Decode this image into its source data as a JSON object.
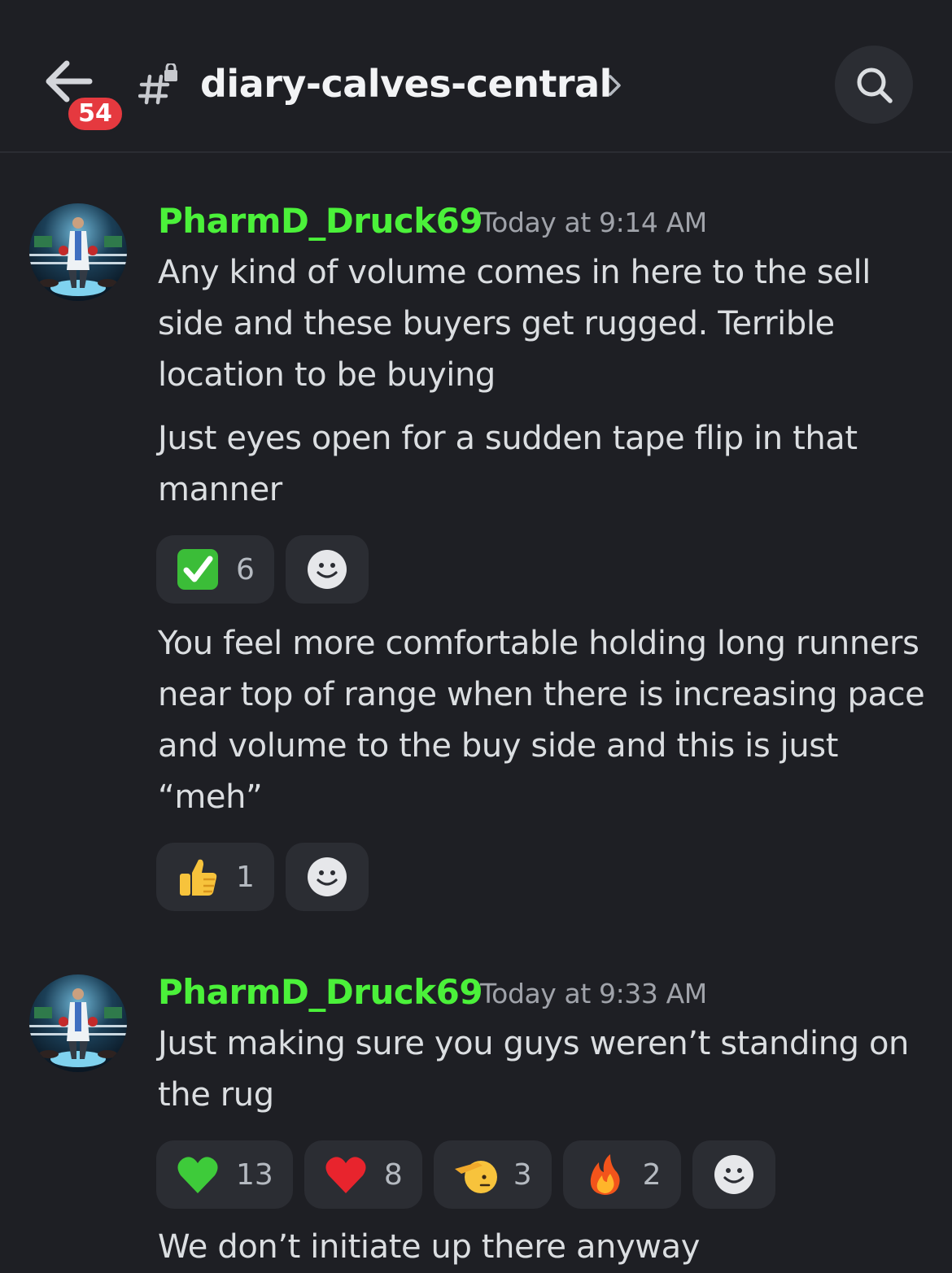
{
  "header": {
    "channel_name": "diary-calves-central",
    "unread_count": "54"
  },
  "messages": [
    {
      "author": "PharmD_Druck69",
      "timestamp": "Today at 9:14 AM",
      "author_color": "#4bf13a",
      "paragraphs": [
        "Any kind of volume comes in here to the sell side and these buyers get rugged. Terrible location to be buying",
        "Just eyes open for a sudden tape flip in that manner"
      ],
      "reactions_1": [
        {
          "emoji": "check-mark-button",
          "count": "6"
        }
      ],
      "paragraph_3": "You feel more comfortable holding long runners near top of range when there is increasing pace and volume to the buy side and this is just “meh”",
      "reactions_2": [
        {
          "emoji": "thumbs-up",
          "count": "1"
        }
      ]
    },
    {
      "author": "PharmD_Druck69",
      "timestamp": "Today at 9:33 AM",
      "author_color": "#4bf13a",
      "paragraphs": [
        "Just making sure you guys weren’t standing on the rug"
      ],
      "reactions": [
        {
          "emoji": "green-heart",
          "count": "13"
        },
        {
          "emoji": "red-heart",
          "count": "8"
        },
        {
          "emoji": "saluting-face",
          "count": "3"
        },
        {
          "emoji": "fire",
          "count": "2"
        }
      ]
    }
  ],
  "cutoff_line": "We don’t initiate up there anyway"
}
